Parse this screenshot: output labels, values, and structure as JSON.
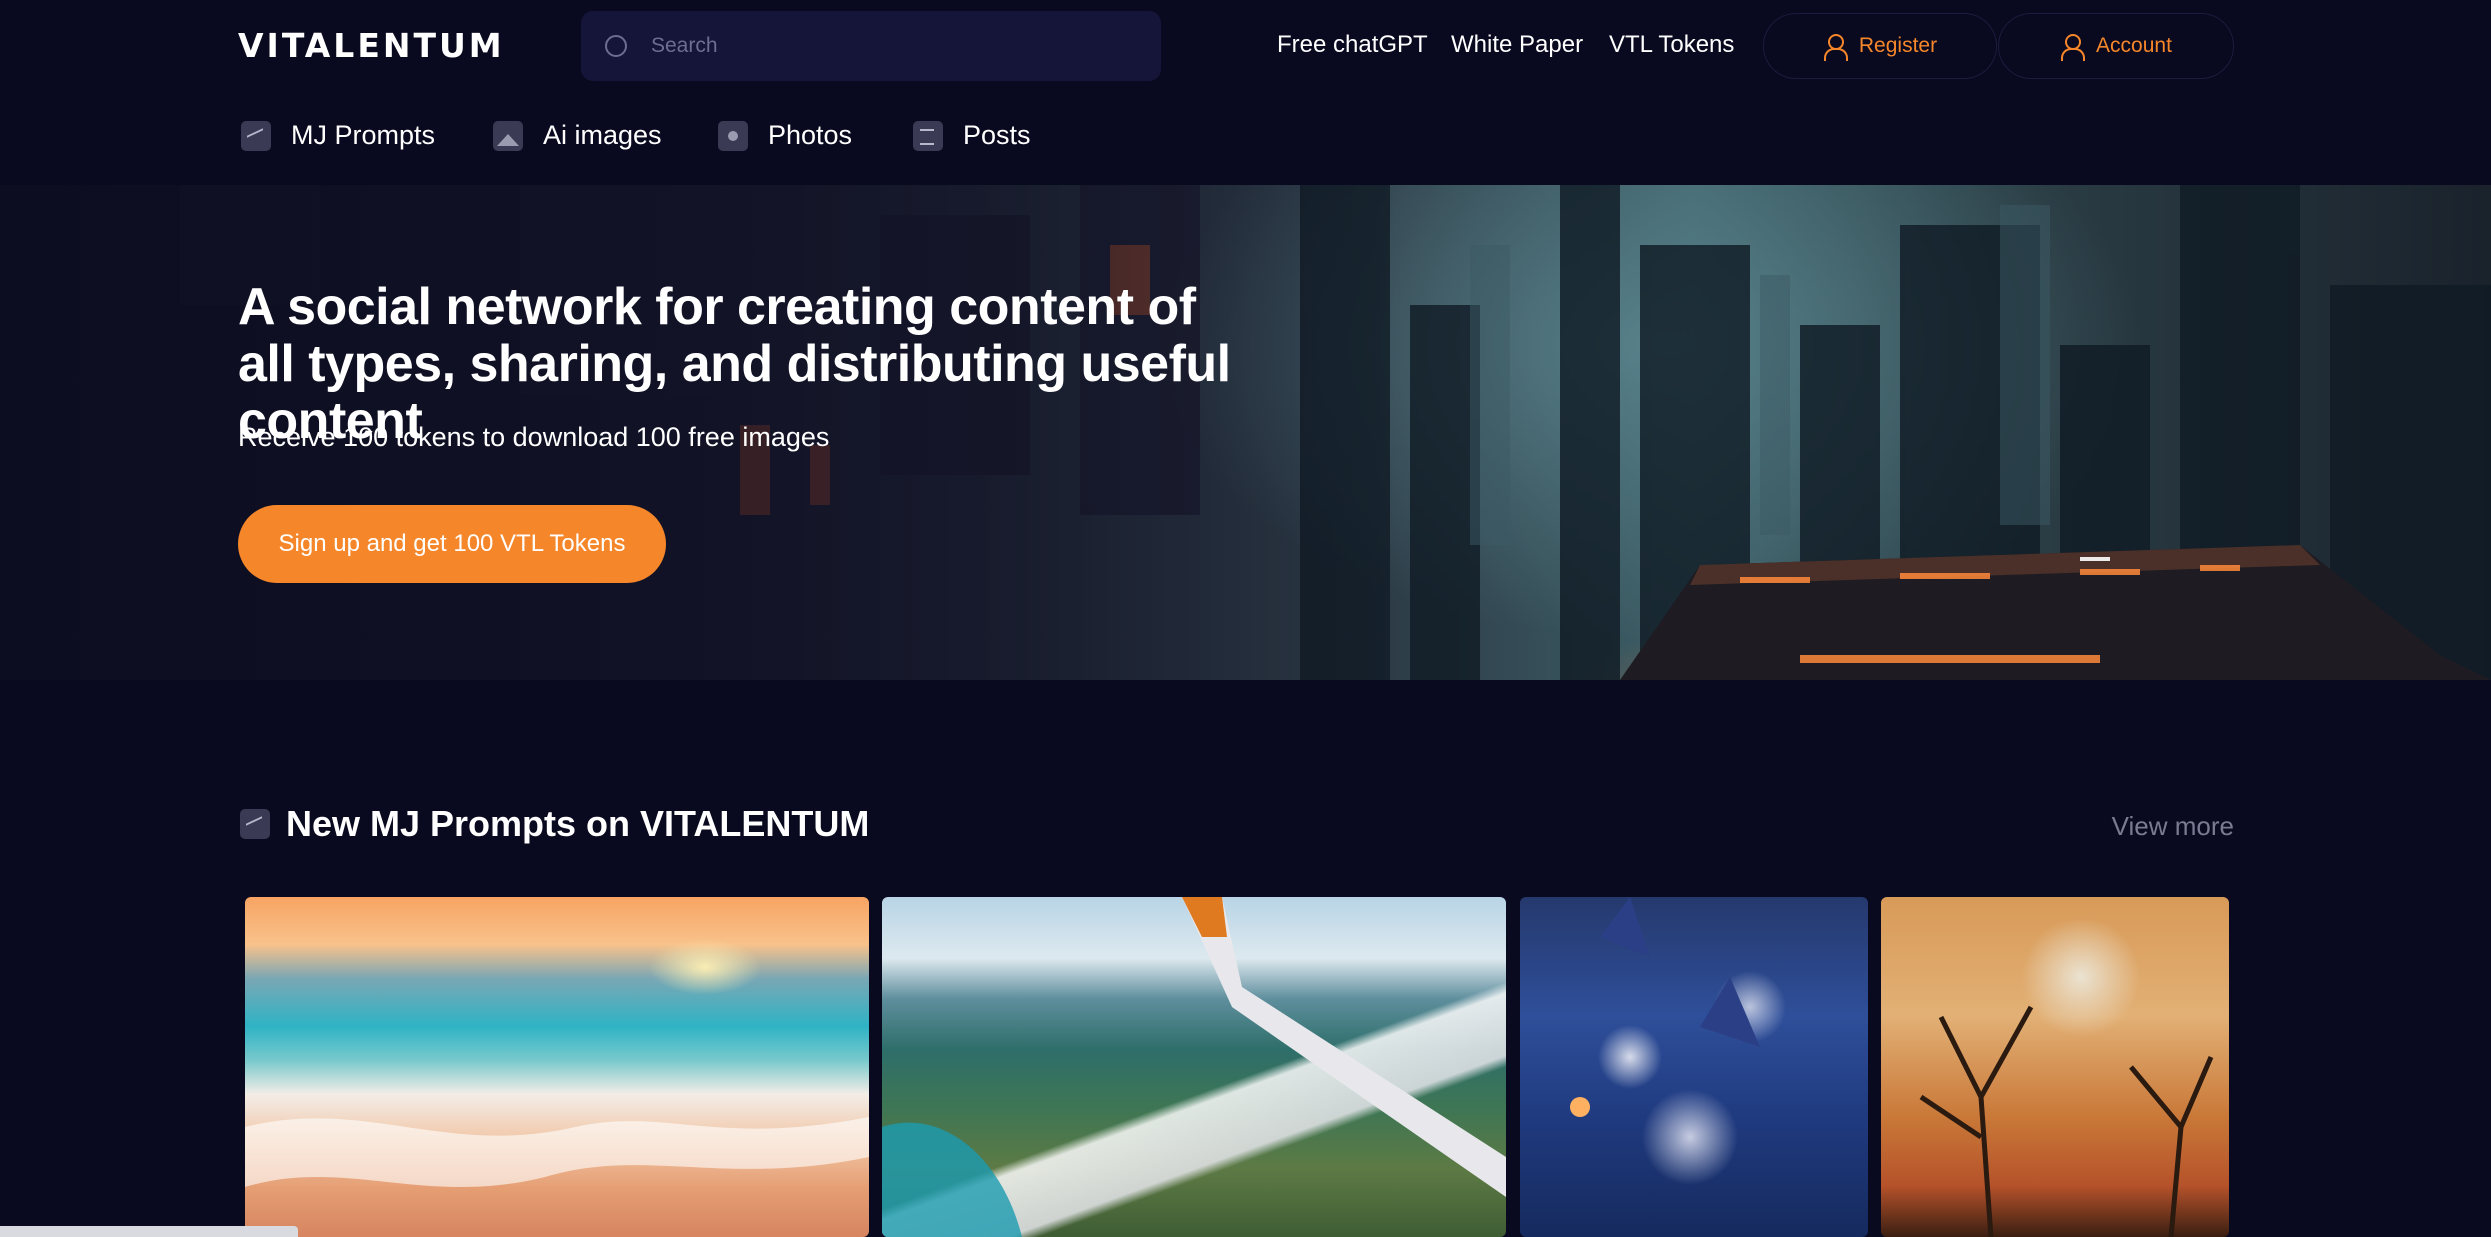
{
  "header": {
    "logo": "VITALENTUM",
    "search_placeholder": "Search",
    "links": [
      "Free chatGPT",
      "White Paper",
      "VTL Tokens"
    ],
    "register_label": "Register",
    "account_label": "Account"
  },
  "categories": [
    {
      "label": "MJ Prompts",
      "icon": "chart-icon"
    },
    {
      "label": "Ai images",
      "icon": "image-icon"
    },
    {
      "label": "Photos",
      "icon": "photo-icon"
    },
    {
      "label": "Posts",
      "icon": "post-icon"
    }
  ],
  "hero": {
    "title": "A social network for creating content of all types, sharing, and distributing useful content",
    "subtitle": "Receive 100 tokens to download 100 free images",
    "cta_label": "Sign up and get 100 VTL Tokens"
  },
  "section": {
    "title": "New MJ Prompts on VITALENTUM",
    "view_more": "View more"
  },
  "colors": {
    "background": "#09091f",
    "accent": "#f5862a",
    "search_bg": "#15153a",
    "muted_text": "#7a7a93"
  }
}
